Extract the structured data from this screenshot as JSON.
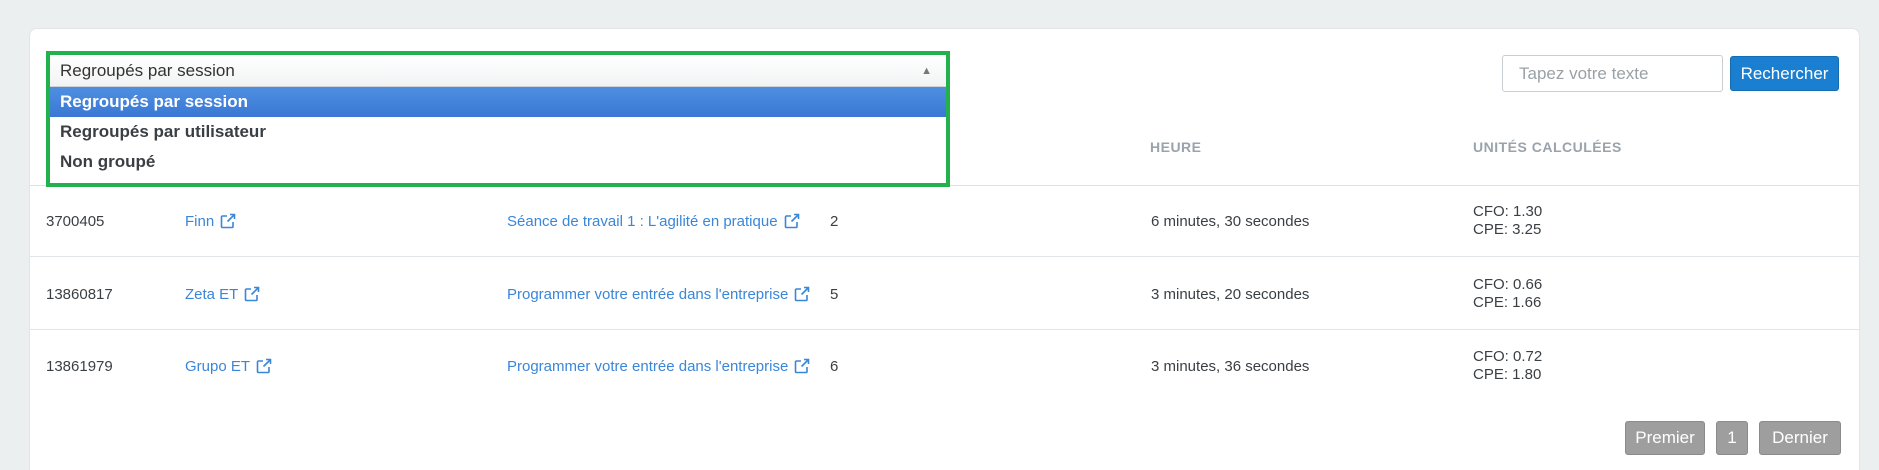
{
  "group_select": {
    "selected": "Regroupés par session",
    "options": [
      "Regroupés par session",
      "Regroupés par utilisateur",
      "Non groupé"
    ]
  },
  "search": {
    "placeholder": "Tapez votre texte",
    "button_label": "Rechercher"
  },
  "table": {
    "headers": {
      "time": "HEURE",
      "units": "UNITÉS CALCULÉES"
    },
    "rows": [
      {
        "id": "3700405",
        "user": "Finn",
        "session": "Séance de travail 1 : L'agilité en pratique",
        "count": "2",
        "time": "6 minutes, 30 secondes",
        "cfo": "CFO: 1.30",
        "cpe": "CPE: 3.25"
      },
      {
        "id": "13860817",
        "user": "Zeta ET",
        "session": "Programmer votre entrée dans l'entreprise",
        "count": "5",
        "time": "3 minutes, 20 secondes",
        "cfo": "CFO: 0.66",
        "cpe": "CPE: 1.66"
      },
      {
        "id": "13861979",
        "user": "Grupo ET",
        "session": "Programmer votre entrée dans l'entreprise",
        "count": "6",
        "time": "3 minutes, 36 secondes",
        "cfo": "CFO: 0.72",
        "cpe": "CPE: 1.80"
      }
    ]
  },
  "pagination": {
    "first": "Premier",
    "page": "1",
    "last": "Dernier"
  },
  "colors": {
    "highlight_border": "#22b14c",
    "selected_option": "#3a78d4",
    "primary_button": "#1a7fd1",
    "link": "#3a86d8"
  }
}
